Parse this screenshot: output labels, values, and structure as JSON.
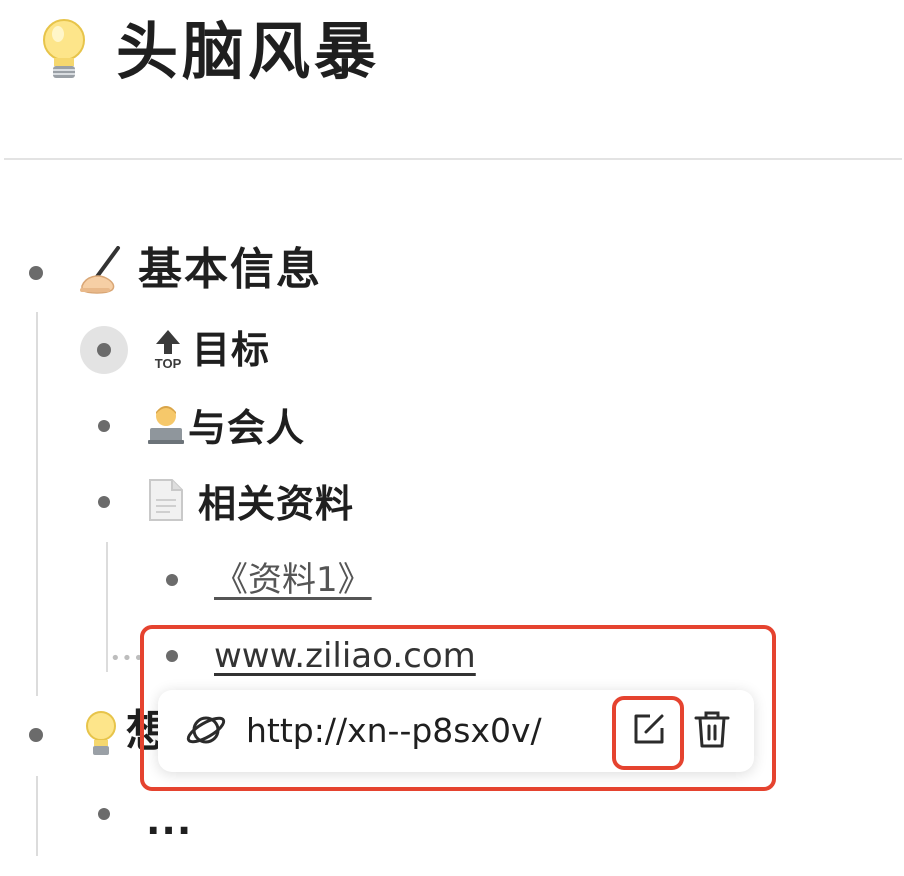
{
  "page": {
    "title": "头脑风暴"
  },
  "outline": {
    "basic_info": {
      "label": "基本信息"
    },
    "goal": {
      "label": "目标",
      "icon_text": "TOP"
    },
    "attendees": {
      "label": "与会人"
    },
    "materials": {
      "label": "相关资料"
    },
    "material_1": {
      "label": "《资料1》"
    },
    "material_2": {
      "label": "www.ziliao.com"
    },
    "ideas": {
      "label": "想"
    },
    "more": {
      "label": "..."
    }
  },
  "link_popover": {
    "url": "http://xn--p8sx0v/",
    "icons": [
      "planet-icon",
      "edit-icon",
      "trash-icon"
    ]
  },
  "colors": {
    "highlight": "#e5432f",
    "bullet": "#6b6b6b",
    "guide": "#dcdcdc"
  }
}
